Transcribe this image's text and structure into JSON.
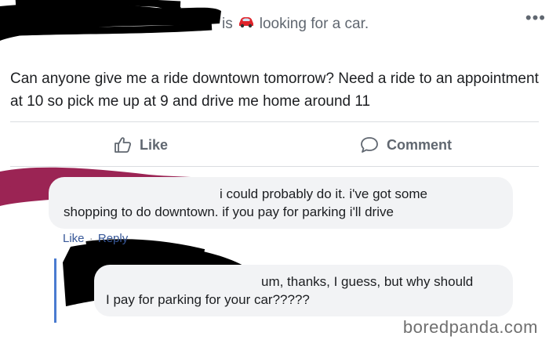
{
  "post": {
    "status_is": "is",
    "status_activity": "looking for a car.",
    "status_icon": "car-icon",
    "more_label": "•••",
    "text": "Can anyone give me a ride downtown tomorrow? Need a ride to an appointment at 10 so pick me up at 9 and drive me home around 11"
  },
  "actions": {
    "like_label": "Like",
    "comment_label": "Comment"
  },
  "comments": [
    {
      "line1": "i could probably do it. i've got some",
      "line2": "shopping to do downtown. if you pay for parking i'll drive",
      "like_link": "Like",
      "reply_link": "Reply",
      "separator": "·"
    },
    {
      "line1": "um, thanks, I guess, but why should",
      "line2": "I pay for parking for your car?????"
    }
  ],
  "watermark": "boredpanda.com",
  "colors": {
    "redaction_black": "#000000",
    "redaction_maroon": "#9b2454",
    "muted_text": "#606770",
    "bubble_bg": "#f2f3f5",
    "link_blue": "#385898",
    "thread_blue": "#4a7bd0"
  }
}
